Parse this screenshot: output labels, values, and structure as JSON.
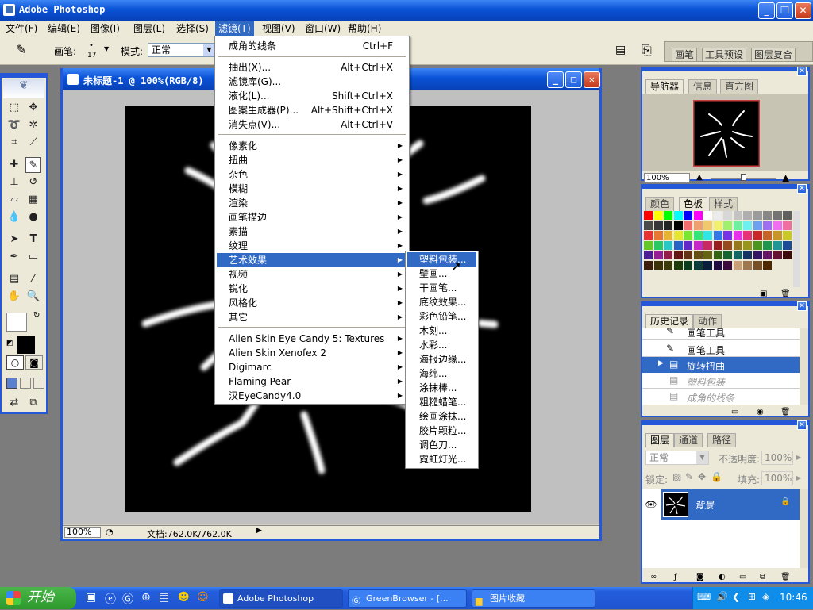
{
  "app": {
    "title": "Adobe Photoshop"
  },
  "menubar": [
    "文件(F)",
    "编辑(E)",
    "图像(I)",
    "图层(L)",
    "选择(S)",
    "滤镜(T)",
    "视图(V)",
    "窗口(W)",
    "帮助(H)"
  ],
  "options": {
    "brush_label": "画笔:",
    "brush_size": "17",
    "mode_label": "模式:",
    "mode_value": "正常",
    "wells": [
      "画笔",
      "工具预设",
      "图层复合"
    ]
  },
  "document": {
    "title": "未标题-1 @ 100%(RGB/8)",
    "zoom": "100%",
    "status": "文档:762.0K/762.0K"
  },
  "filter_menu": {
    "top": {
      "label": "成角的线条",
      "shortcut": "Ctrl+F"
    },
    "group1": [
      {
        "label": "抽出(X)...",
        "shortcut": "Alt+Ctrl+X"
      },
      {
        "label": "滤镜库(G)...",
        "shortcut": ""
      },
      {
        "label": "液化(L)...",
        "shortcut": "Shift+Ctrl+X"
      },
      {
        "label": "图案生成器(P)...",
        "shortcut": "Alt+Shift+Ctrl+X"
      },
      {
        "label": "消失点(V)...",
        "shortcut": "Alt+Ctrl+V"
      }
    ],
    "group2": [
      "像素化",
      "扭曲",
      "杂色",
      "模糊",
      "渲染",
      "画笔描边",
      "素描",
      "纹理",
      "艺术效果",
      "视频",
      "锐化",
      "风格化",
      "其它"
    ],
    "group3": [
      "Alien Skin Eye Candy 5: Textures",
      "Alien Skin Xenofex 2",
      "Digimarc",
      "Flaming Pear",
      "汉EyeCandy4.0"
    ]
  },
  "artistic_submenu": [
    "塑料包装...",
    "壁画...",
    "干画笔...",
    "底纹效果...",
    "彩色铅笔...",
    "木刻...",
    "水彩...",
    "海报边缘...",
    "海绵...",
    "涂抹棒...",
    "粗糙蜡笔...",
    "绘画涂抹...",
    "胶片颗粒...",
    "调色刀...",
    "霓虹灯光..."
  ],
  "navigator": {
    "tabs": [
      "导航器",
      "信息",
      "直方图"
    ],
    "zoom": "100%"
  },
  "swatches": {
    "tabs": [
      "颜色",
      "色板",
      "样式"
    ]
  },
  "history": {
    "tabs": [
      "历史记录",
      "动作"
    ],
    "items": [
      "画笔工具",
      "画笔工具",
      "旋转扭曲",
      "塑料包装",
      "成角的线条"
    ]
  },
  "layers": {
    "tabs": [
      "图层",
      "通道",
      "路径"
    ],
    "mode": "正常",
    "opacity_label": "不透明度:",
    "opacity": "100%",
    "lock_label": "锁定:",
    "fill_label": "填充:",
    "fill": "100%",
    "layer_name": "背景"
  },
  "taskbar": {
    "start": "开始",
    "tasks": [
      "Adobe Photoshop",
      "GreenBrowser - [...",
      "图片收藏"
    ],
    "time": "10:46"
  },
  "colors": {
    "xp_blue": "#0a52d6",
    "highlight": "#316ac5",
    "panel_bg": "#ece9d8"
  }
}
